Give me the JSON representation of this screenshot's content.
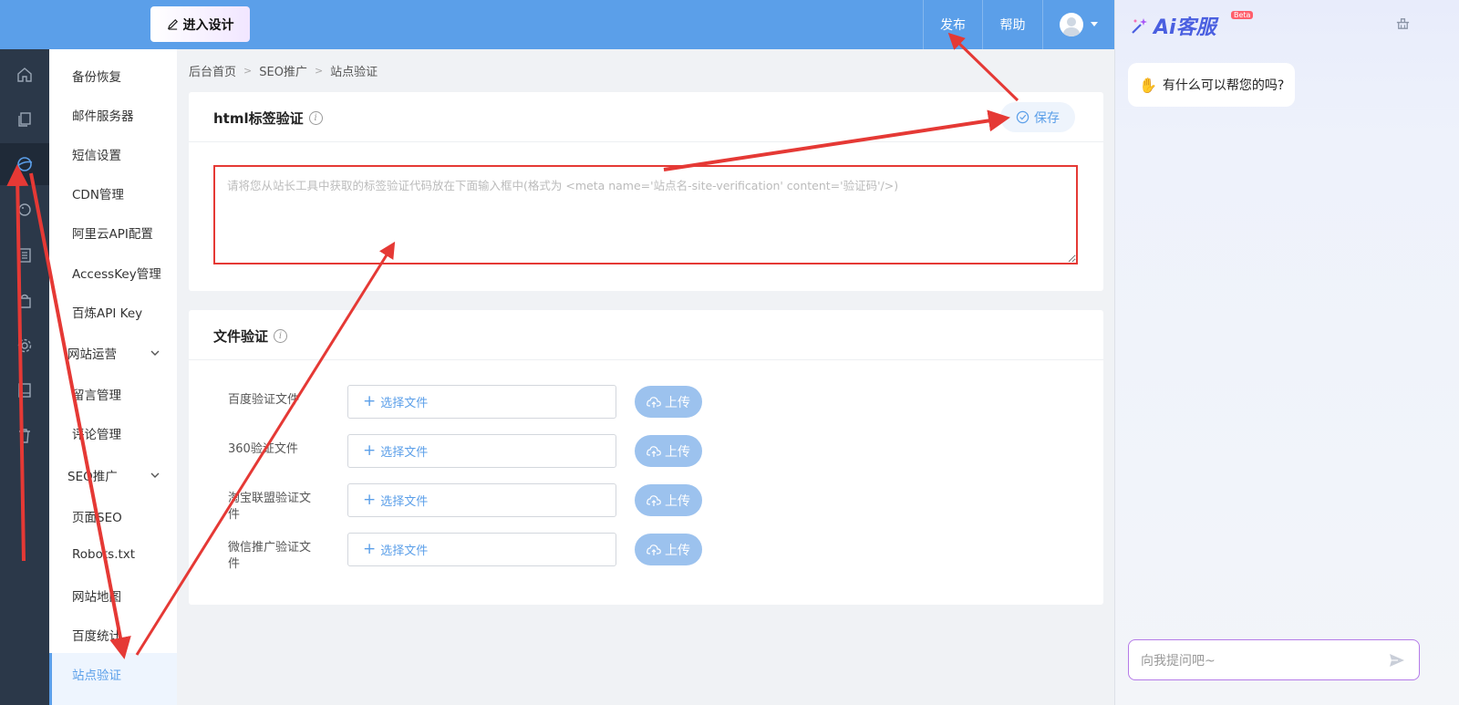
{
  "header": {
    "design_label": "进入设计",
    "publish_label": "发布",
    "help_label": "帮助"
  },
  "sidebar": {
    "items": [
      {
        "label": "备份恢复"
      },
      {
        "label": "邮件服务器"
      },
      {
        "label": "短信设置"
      },
      {
        "label": "CDN管理"
      },
      {
        "label": "阿里云API配置"
      },
      {
        "label": "AccessKey管理"
      },
      {
        "label": "百炼API Key"
      }
    ],
    "group_ops": "网站运营",
    "ops_items": [
      {
        "label": "留言管理"
      },
      {
        "label": "评论管理"
      }
    ],
    "group_seo": "SEO推广",
    "seo_items": [
      {
        "label": "页面SEO"
      },
      {
        "label": "Robots.txt"
      },
      {
        "label": "网站地图"
      },
      {
        "label": "百度统计"
      },
      {
        "label": "站点验证"
      }
    ]
  },
  "breadcrumb": [
    "后台首页",
    "SEO推广",
    "站点验证"
  ],
  "html_verify": {
    "title": "html标签验证",
    "save_label": "保存",
    "placeholder": "请将您从站长工具中获取的标签验证代码放在下面输入框中(格式为 <meta name='站点名-site-verification' content='验证码'/>)"
  },
  "file_verify": {
    "title": "文件验证",
    "choose_label": "选择文件",
    "upload_label": "上传",
    "rows": [
      {
        "label": "百度验证文件"
      },
      {
        "label": "360验证文件"
      },
      {
        "label": "淘宝联盟验证文件"
      },
      {
        "label": "微信推广验证文件"
      }
    ]
  },
  "chat": {
    "logo_text": "Ai客服",
    "beta": "Beta",
    "greeting": "有什么可以帮您的吗?",
    "input_placeholder": "向我提问吧~"
  },
  "colors": {
    "accent": "#5b9fe9",
    "annotation": "#e53935",
    "sidebar_dark": "#2b3849"
  }
}
